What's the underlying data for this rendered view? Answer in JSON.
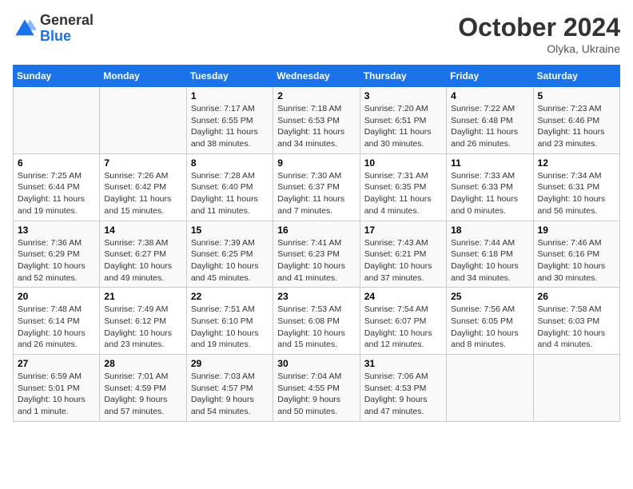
{
  "logo": {
    "general": "General",
    "blue": "Blue"
  },
  "header": {
    "month": "October 2024",
    "location": "Olyka, Ukraine"
  },
  "weekdays": [
    "Sunday",
    "Monday",
    "Tuesday",
    "Wednesday",
    "Thursday",
    "Friday",
    "Saturday"
  ],
  "weeks": [
    [
      {
        "day": "",
        "info": ""
      },
      {
        "day": "",
        "info": ""
      },
      {
        "day": "1",
        "info": "Sunrise: 7:17 AM\nSunset: 6:55 PM\nDaylight: 11 hours and 38 minutes."
      },
      {
        "day": "2",
        "info": "Sunrise: 7:18 AM\nSunset: 6:53 PM\nDaylight: 11 hours and 34 minutes."
      },
      {
        "day": "3",
        "info": "Sunrise: 7:20 AM\nSunset: 6:51 PM\nDaylight: 11 hours and 30 minutes."
      },
      {
        "day": "4",
        "info": "Sunrise: 7:22 AM\nSunset: 6:48 PM\nDaylight: 11 hours and 26 minutes."
      },
      {
        "day": "5",
        "info": "Sunrise: 7:23 AM\nSunset: 6:46 PM\nDaylight: 11 hours and 23 minutes."
      }
    ],
    [
      {
        "day": "6",
        "info": "Sunrise: 7:25 AM\nSunset: 6:44 PM\nDaylight: 11 hours and 19 minutes."
      },
      {
        "day": "7",
        "info": "Sunrise: 7:26 AM\nSunset: 6:42 PM\nDaylight: 11 hours and 15 minutes."
      },
      {
        "day": "8",
        "info": "Sunrise: 7:28 AM\nSunset: 6:40 PM\nDaylight: 11 hours and 11 minutes."
      },
      {
        "day": "9",
        "info": "Sunrise: 7:30 AM\nSunset: 6:37 PM\nDaylight: 11 hours and 7 minutes."
      },
      {
        "day": "10",
        "info": "Sunrise: 7:31 AM\nSunset: 6:35 PM\nDaylight: 11 hours and 4 minutes."
      },
      {
        "day": "11",
        "info": "Sunrise: 7:33 AM\nSunset: 6:33 PM\nDaylight: 11 hours and 0 minutes."
      },
      {
        "day": "12",
        "info": "Sunrise: 7:34 AM\nSunset: 6:31 PM\nDaylight: 10 hours and 56 minutes."
      }
    ],
    [
      {
        "day": "13",
        "info": "Sunrise: 7:36 AM\nSunset: 6:29 PM\nDaylight: 10 hours and 52 minutes."
      },
      {
        "day": "14",
        "info": "Sunrise: 7:38 AM\nSunset: 6:27 PM\nDaylight: 10 hours and 49 minutes."
      },
      {
        "day": "15",
        "info": "Sunrise: 7:39 AM\nSunset: 6:25 PM\nDaylight: 10 hours and 45 minutes."
      },
      {
        "day": "16",
        "info": "Sunrise: 7:41 AM\nSunset: 6:23 PM\nDaylight: 10 hours and 41 minutes."
      },
      {
        "day": "17",
        "info": "Sunrise: 7:43 AM\nSunset: 6:21 PM\nDaylight: 10 hours and 37 minutes."
      },
      {
        "day": "18",
        "info": "Sunrise: 7:44 AM\nSunset: 6:18 PM\nDaylight: 10 hours and 34 minutes."
      },
      {
        "day": "19",
        "info": "Sunrise: 7:46 AM\nSunset: 6:16 PM\nDaylight: 10 hours and 30 minutes."
      }
    ],
    [
      {
        "day": "20",
        "info": "Sunrise: 7:48 AM\nSunset: 6:14 PM\nDaylight: 10 hours and 26 minutes."
      },
      {
        "day": "21",
        "info": "Sunrise: 7:49 AM\nSunset: 6:12 PM\nDaylight: 10 hours and 23 minutes."
      },
      {
        "day": "22",
        "info": "Sunrise: 7:51 AM\nSunset: 6:10 PM\nDaylight: 10 hours and 19 minutes."
      },
      {
        "day": "23",
        "info": "Sunrise: 7:53 AM\nSunset: 6:08 PM\nDaylight: 10 hours and 15 minutes."
      },
      {
        "day": "24",
        "info": "Sunrise: 7:54 AM\nSunset: 6:07 PM\nDaylight: 10 hours and 12 minutes."
      },
      {
        "day": "25",
        "info": "Sunrise: 7:56 AM\nSunset: 6:05 PM\nDaylight: 10 hours and 8 minutes."
      },
      {
        "day": "26",
        "info": "Sunrise: 7:58 AM\nSunset: 6:03 PM\nDaylight: 10 hours and 4 minutes."
      }
    ],
    [
      {
        "day": "27",
        "info": "Sunrise: 6:59 AM\nSunset: 5:01 PM\nDaylight: 10 hours and 1 minute."
      },
      {
        "day": "28",
        "info": "Sunrise: 7:01 AM\nSunset: 4:59 PM\nDaylight: 9 hours and 57 minutes."
      },
      {
        "day": "29",
        "info": "Sunrise: 7:03 AM\nSunset: 4:57 PM\nDaylight: 9 hours and 54 minutes."
      },
      {
        "day": "30",
        "info": "Sunrise: 7:04 AM\nSunset: 4:55 PM\nDaylight: 9 hours and 50 minutes."
      },
      {
        "day": "31",
        "info": "Sunrise: 7:06 AM\nSunset: 4:53 PM\nDaylight: 9 hours and 47 minutes."
      },
      {
        "day": "",
        "info": ""
      },
      {
        "day": "",
        "info": ""
      }
    ]
  ]
}
